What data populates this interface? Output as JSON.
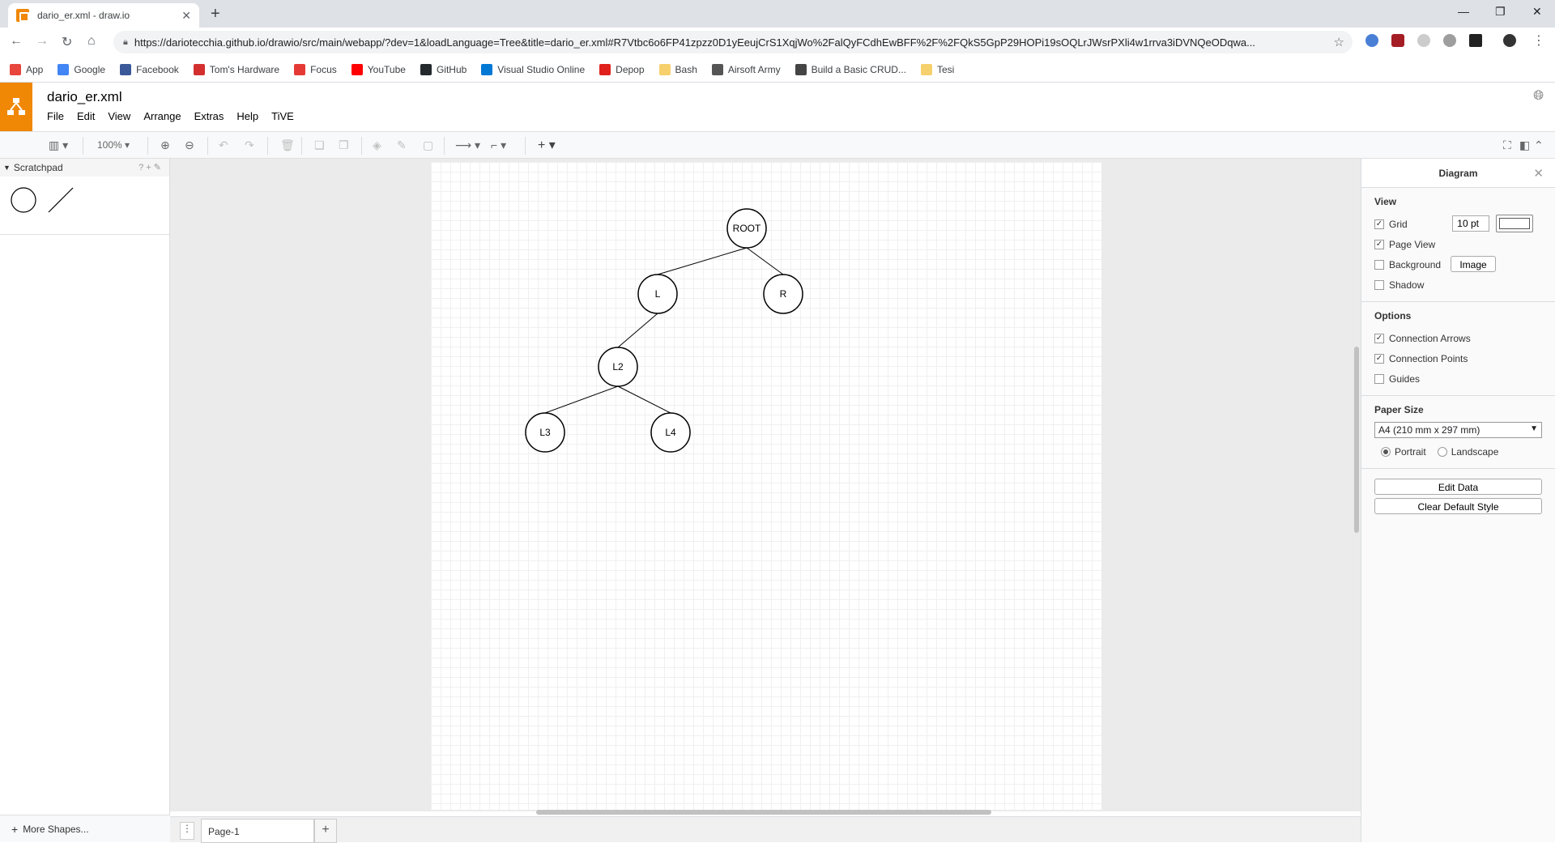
{
  "browser": {
    "tab_title": "dario_er.xml - draw.io",
    "url": "https://dariotecchia.github.io/drawio/src/main/webapp/?dev=1&loadLanguage=Tree&title=dario_er.xml#R7Vtbc6o6FP41zpzz0D1yEeujCrS1XqjWo%2FalQyFCdhEwBFF%2F%2FQkS5GpP29HOPi19sOQLrJWsrPXli4w1rrva3iDVNQeODqwa..."
  },
  "bookmarks": [
    {
      "label": "App",
      "icon": "apps-grid-icon",
      "color": "#e8453c"
    },
    {
      "label": "Google",
      "icon": "google-icon",
      "color": "#4285f4"
    },
    {
      "label": "Facebook",
      "icon": "facebook-icon",
      "color": "#3b5998"
    },
    {
      "label": "Tom's Hardware",
      "icon": "toms-hardware-icon",
      "color": "#d32f2f"
    },
    {
      "label": "Focus",
      "icon": "focus-icon",
      "color": "#e53935"
    },
    {
      "label": "YouTube",
      "icon": "youtube-icon",
      "color": "#ff0000"
    },
    {
      "label": "GitHub",
      "icon": "github-icon",
      "color": "#24292e"
    },
    {
      "label": "Visual Studio Online",
      "icon": "vs-online-icon",
      "color": "#0078d4"
    },
    {
      "label": "Depop",
      "icon": "depop-icon",
      "color": "#e0201b"
    },
    {
      "label": "Bash",
      "icon": "folder-icon",
      "color": "#f6d06c"
    },
    {
      "label": "Airsoft Army",
      "icon": "airsoft-army-icon",
      "color": "#555555"
    },
    {
      "label": "Build a Basic CRUD...",
      "icon": "code-icon",
      "color": "#444444"
    },
    {
      "label": "Tesi",
      "icon": "folder-icon",
      "color": "#f6d06c"
    }
  ],
  "app": {
    "filename": "dario_er.xml",
    "menu": [
      "File",
      "Edit",
      "View",
      "Arrange",
      "Extras",
      "Help",
      "TiVE"
    ],
    "zoom": "100%",
    "accent": "#f08705"
  },
  "sidebar": {
    "scratchpad_title": "Scratchpad",
    "scratch_tools": "? + ✎",
    "more_shapes": "More Shapes..."
  },
  "diagram": {
    "nodes": [
      {
        "id": "root",
        "label": "ROOT"
      },
      {
        "id": "l",
        "label": "L"
      },
      {
        "id": "r",
        "label": "R"
      },
      {
        "id": "l2",
        "label": "L2"
      },
      {
        "id": "l3",
        "label": "L3"
      },
      {
        "id": "l4",
        "label": "L4"
      }
    ],
    "edges": [
      [
        "root",
        "l"
      ],
      [
        "root",
        "r"
      ],
      [
        "l",
        "l2"
      ],
      [
        "l2",
        "l3"
      ],
      [
        "l2",
        "l4"
      ]
    ]
  },
  "pages": {
    "current": "Page-1"
  },
  "panel": {
    "title": "Diagram",
    "view_title": "View",
    "grid_label": "Grid",
    "grid_size": "10 pt",
    "page_view_label": "Page View",
    "background_label": "Background",
    "image_button": "Image",
    "shadow_label": "Shadow",
    "options_title": "Options",
    "connection_arrows_label": "Connection Arrows",
    "connection_points_label": "Connection Points",
    "guides_label": "Guides",
    "paper_size_title": "Paper Size",
    "paper_size_value": "A4 (210 mm x 297 mm)",
    "portrait_label": "Portrait",
    "landscape_label": "Landscape",
    "edit_data_button": "Edit Data",
    "clear_style_button": "Clear Default Style"
  }
}
